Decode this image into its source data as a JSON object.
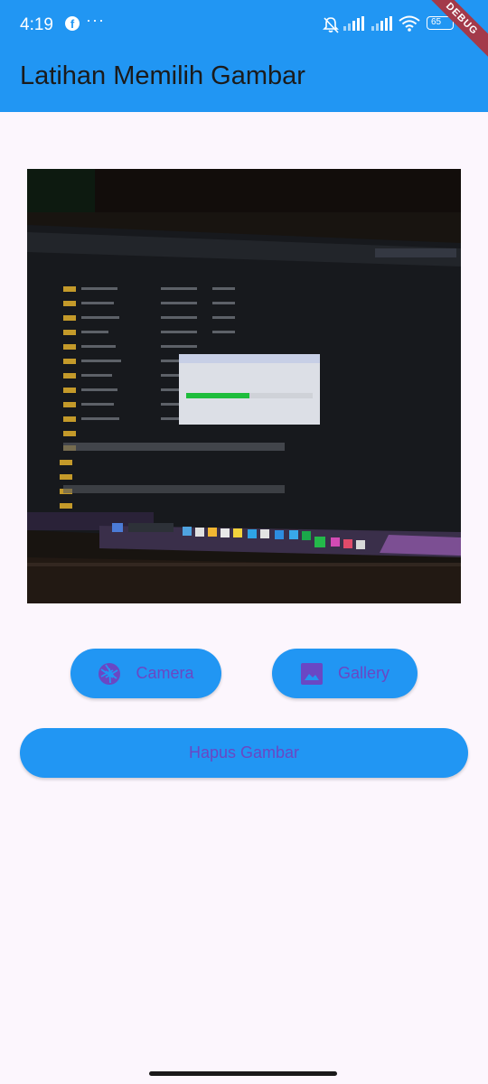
{
  "status_bar": {
    "time": "4:19",
    "battery": "65",
    "icons": [
      "facebook-icon",
      "more-dots-icon",
      "notifications-off-icon",
      "signal-icon",
      "signal-icon",
      "wifi-icon",
      "battery-icon"
    ]
  },
  "app_bar": {
    "title": "Latihan Memilih Gambar",
    "debug_banner": "DEBUG"
  },
  "image": {
    "icon": "photo-preview"
  },
  "buttons": {
    "camera": "Camera",
    "gallery": "Gallery",
    "delete": "Hapus Gambar"
  },
  "colors": {
    "primary": "#2196f3",
    "button_text": "#6a47c4",
    "background": "#fcf6fd",
    "title_text": "#1b1b1b"
  }
}
